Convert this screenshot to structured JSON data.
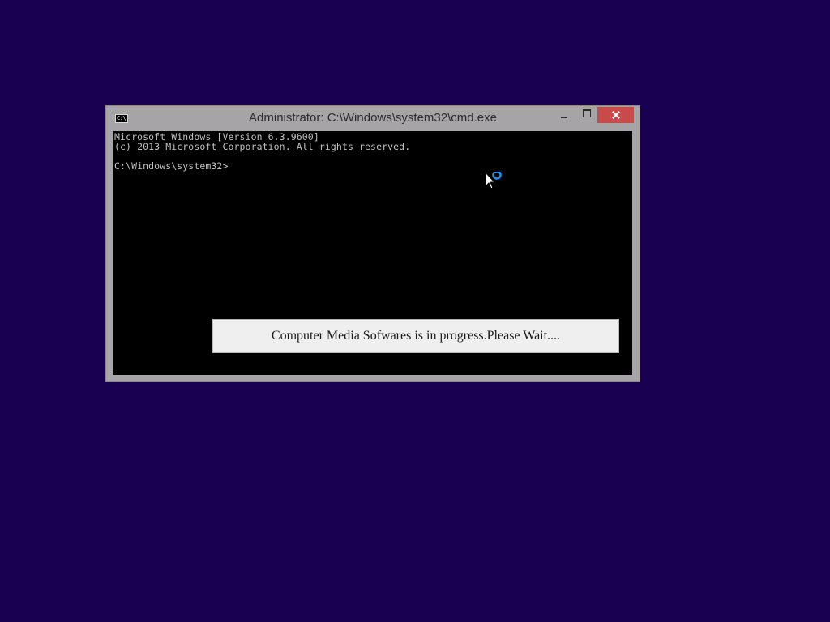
{
  "window": {
    "title": "Administrator: C:\\Windows\\system32\\cmd.exe",
    "app_icon_text": "C:\\",
    "icon": "command-prompt-icon"
  },
  "console": {
    "lines": [
      "Microsoft Windows [Version 6.3.9600]",
      "(c) 2013 Microsoft Corporation. All rights reserved.",
      "C:\\Windows\\system32>"
    ]
  },
  "dialog": {
    "message": "Computer Media Sofwares is in progress.Please Wait...."
  },
  "colors": {
    "desktop": "#1a0050",
    "window_frame": "#a7a4a7",
    "close_button": "#c94a4a",
    "console_bg": "#000000",
    "console_text": "#c0c0c0"
  },
  "cursor": {
    "icon": "busy-arrow-cursor-icon"
  }
}
